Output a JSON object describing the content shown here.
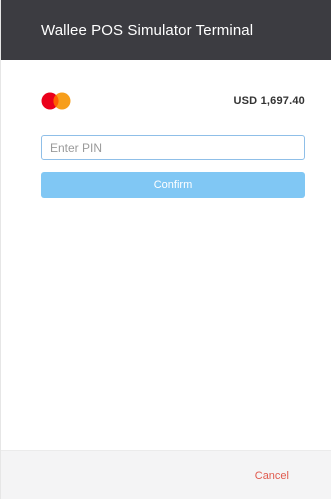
{
  "header": {
    "title": "Wallee POS Simulator Terminal"
  },
  "payment": {
    "card_icon": "mastercard-logo",
    "card_colors": {
      "left": "#eb001b",
      "right": "#f79e1b",
      "overlap": "#ff5f00"
    },
    "amount": "USD 1,697.40"
  },
  "pin": {
    "value": "",
    "placeholder": "Enter PIN"
  },
  "actions": {
    "confirm_label": "Confirm",
    "cancel_label": "Cancel"
  },
  "colors": {
    "header_bg": "#3c3c41",
    "confirm_bg": "#80c7f4",
    "cancel_text": "#e05a4e",
    "footer_bg": "#f4f4f5"
  }
}
